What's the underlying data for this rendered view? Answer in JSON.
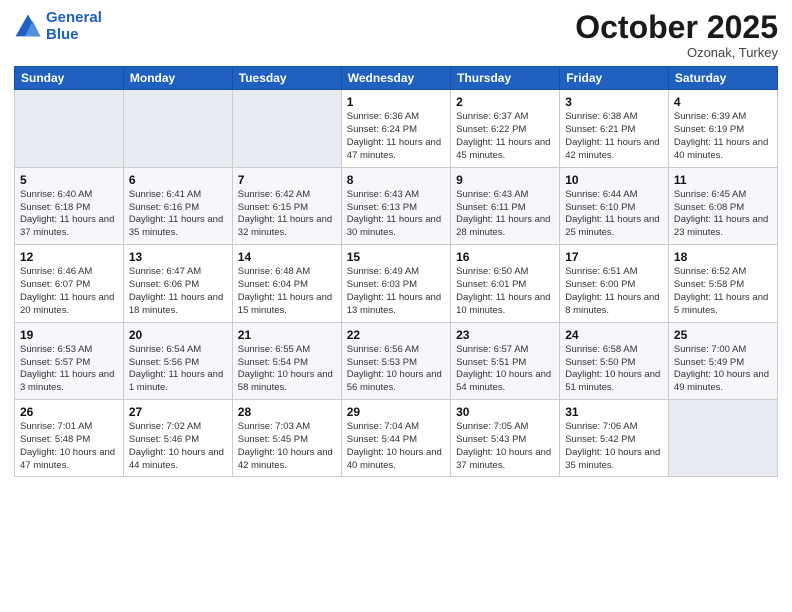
{
  "header": {
    "logo_line1": "General",
    "logo_line2": "Blue",
    "month": "October 2025",
    "location": "Ozonak, Turkey"
  },
  "weekdays": [
    "Sunday",
    "Monday",
    "Tuesday",
    "Wednesday",
    "Thursday",
    "Friday",
    "Saturday"
  ],
  "weeks": [
    [
      null,
      null,
      null,
      {
        "day": "1",
        "sunrise": "Sunrise: 6:36 AM",
        "sunset": "Sunset: 6:24 PM",
        "daylight": "Daylight: 11 hours and 47 minutes."
      },
      {
        "day": "2",
        "sunrise": "Sunrise: 6:37 AM",
        "sunset": "Sunset: 6:22 PM",
        "daylight": "Daylight: 11 hours and 45 minutes."
      },
      {
        "day": "3",
        "sunrise": "Sunrise: 6:38 AM",
        "sunset": "Sunset: 6:21 PM",
        "daylight": "Daylight: 11 hours and 42 minutes."
      },
      {
        "day": "4",
        "sunrise": "Sunrise: 6:39 AM",
        "sunset": "Sunset: 6:19 PM",
        "daylight": "Daylight: 11 hours and 40 minutes."
      }
    ],
    [
      {
        "day": "5",
        "sunrise": "Sunrise: 6:40 AM",
        "sunset": "Sunset: 6:18 PM",
        "daylight": "Daylight: 11 hours and 37 minutes."
      },
      {
        "day": "6",
        "sunrise": "Sunrise: 6:41 AM",
        "sunset": "Sunset: 6:16 PM",
        "daylight": "Daylight: 11 hours and 35 minutes."
      },
      {
        "day": "7",
        "sunrise": "Sunrise: 6:42 AM",
        "sunset": "Sunset: 6:15 PM",
        "daylight": "Daylight: 11 hours and 32 minutes."
      },
      {
        "day": "8",
        "sunrise": "Sunrise: 6:43 AM",
        "sunset": "Sunset: 6:13 PM",
        "daylight": "Daylight: 11 hours and 30 minutes."
      },
      {
        "day": "9",
        "sunrise": "Sunrise: 6:43 AM",
        "sunset": "Sunset: 6:11 PM",
        "daylight": "Daylight: 11 hours and 28 minutes."
      },
      {
        "day": "10",
        "sunrise": "Sunrise: 6:44 AM",
        "sunset": "Sunset: 6:10 PM",
        "daylight": "Daylight: 11 hours and 25 minutes."
      },
      {
        "day": "11",
        "sunrise": "Sunrise: 6:45 AM",
        "sunset": "Sunset: 6:08 PM",
        "daylight": "Daylight: 11 hours and 23 minutes."
      }
    ],
    [
      {
        "day": "12",
        "sunrise": "Sunrise: 6:46 AM",
        "sunset": "Sunset: 6:07 PM",
        "daylight": "Daylight: 11 hours and 20 minutes."
      },
      {
        "day": "13",
        "sunrise": "Sunrise: 6:47 AM",
        "sunset": "Sunset: 6:06 PM",
        "daylight": "Daylight: 11 hours and 18 minutes."
      },
      {
        "day": "14",
        "sunrise": "Sunrise: 6:48 AM",
        "sunset": "Sunset: 6:04 PM",
        "daylight": "Daylight: 11 hours and 15 minutes."
      },
      {
        "day": "15",
        "sunrise": "Sunrise: 6:49 AM",
        "sunset": "Sunset: 6:03 PM",
        "daylight": "Daylight: 11 hours and 13 minutes."
      },
      {
        "day": "16",
        "sunrise": "Sunrise: 6:50 AM",
        "sunset": "Sunset: 6:01 PM",
        "daylight": "Daylight: 11 hours and 10 minutes."
      },
      {
        "day": "17",
        "sunrise": "Sunrise: 6:51 AM",
        "sunset": "Sunset: 6:00 PM",
        "daylight": "Daylight: 11 hours and 8 minutes."
      },
      {
        "day": "18",
        "sunrise": "Sunrise: 6:52 AM",
        "sunset": "Sunset: 5:58 PM",
        "daylight": "Daylight: 11 hours and 5 minutes."
      }
    ],
    [
      {
        "day": "19",
        "sunrise": "Sunrise: 6:53 AM",
        "sunset": "Sunset: 5:57 PM",
        "daylight": "Daylight: 11 hours and 3 minutes."
      },
      {
        "day": "20",
        "sunrise": "Sunrise: 6:54 AM",
        "sunset": "Sunset: 5:56 PM",
        "daylight": "Daylight: 11 hours and 1 minute."
      },
      {
        "day": "21",
        "sunrise": "Sunrise: 6:55 AM",
        "sunset": "Sunset: 5:54 PM",
        "daylight": "Daylight: 10 hours and 58 minutes."
      },
      {
        "day": "22",
        "sunrise": "Sunrise: 6:56 AM",
        "sunset": "Sunset: 5:53 PM",
        "daylight": "Daylight: 10 hours and 56 minutes."
      },
      {
        "day": "23",
        "sunrise": "Sunrise: 6:57 AM",
        "sunset": "Sunset: 5:51 PM",
        "daylight": "Daylight: 10 hours and 54 minutes."
      },
      {
        "day": "24",
        "sunrise": "Sunrise: 6:58 AM",
        "sunset": "Sunset: 5:50 PM",
        "daylight": "Daylight: 10 hours and 51 minutes."
      },
      {
        "day": "25",
        "sunrise": "Sunrise: 7:00 AM",
        "sunset": "Sunset: 5:49 PM",
        "daylight": "Daylight: 10 hours and 49 minutes."
      }
    ],
    [
      {
        "day": "26",
        "sunrise": "Sunrise: 7:01 AM",
        "sunset": "Sunset: 5:48 PM",
        "daylight": "Daylight: 10 hours and 47 minutes."
      },
      {
        "day": "27",
        "sunrise": "Sunrise: 7:02 AM",
        "sunset": "Sunset: 5:46 PM",
        "daylight": "Daylight: 10 hours and 44 minutes."
      },
      {
        "day": "28",
        "sunrise": "Sunrise: 7:03 AM",
        "sunset": "Sunset: 5:45 PM",
        "daylight": "Daylight: 10 hours and 42 minutes."
      },
      {
        "day": "29",
        "sunrise": "Sunrise: 7:04 AM",
        "sunset": "Sunset: 5:44 PM",
        "daylight": "Daylight: 10 hours and 40 minutes."
      },
      {
        "day": "30",
        "sunrise": "Sunrise: 7:05 AM",
        "sunset": "Sunset: 5:43 PM",
        "daylight": "Daylight: 10 hours and 37 minutes."
      },
      {
        "day": "31",
        "sunrise": "Sunrise: 7:06 AM",
        "sunset": "Sunset: 5:42 PM",
        "daylight": "Daylight: 10 hours and 35 minutes."
      },
      null
    ]
  ]
}
